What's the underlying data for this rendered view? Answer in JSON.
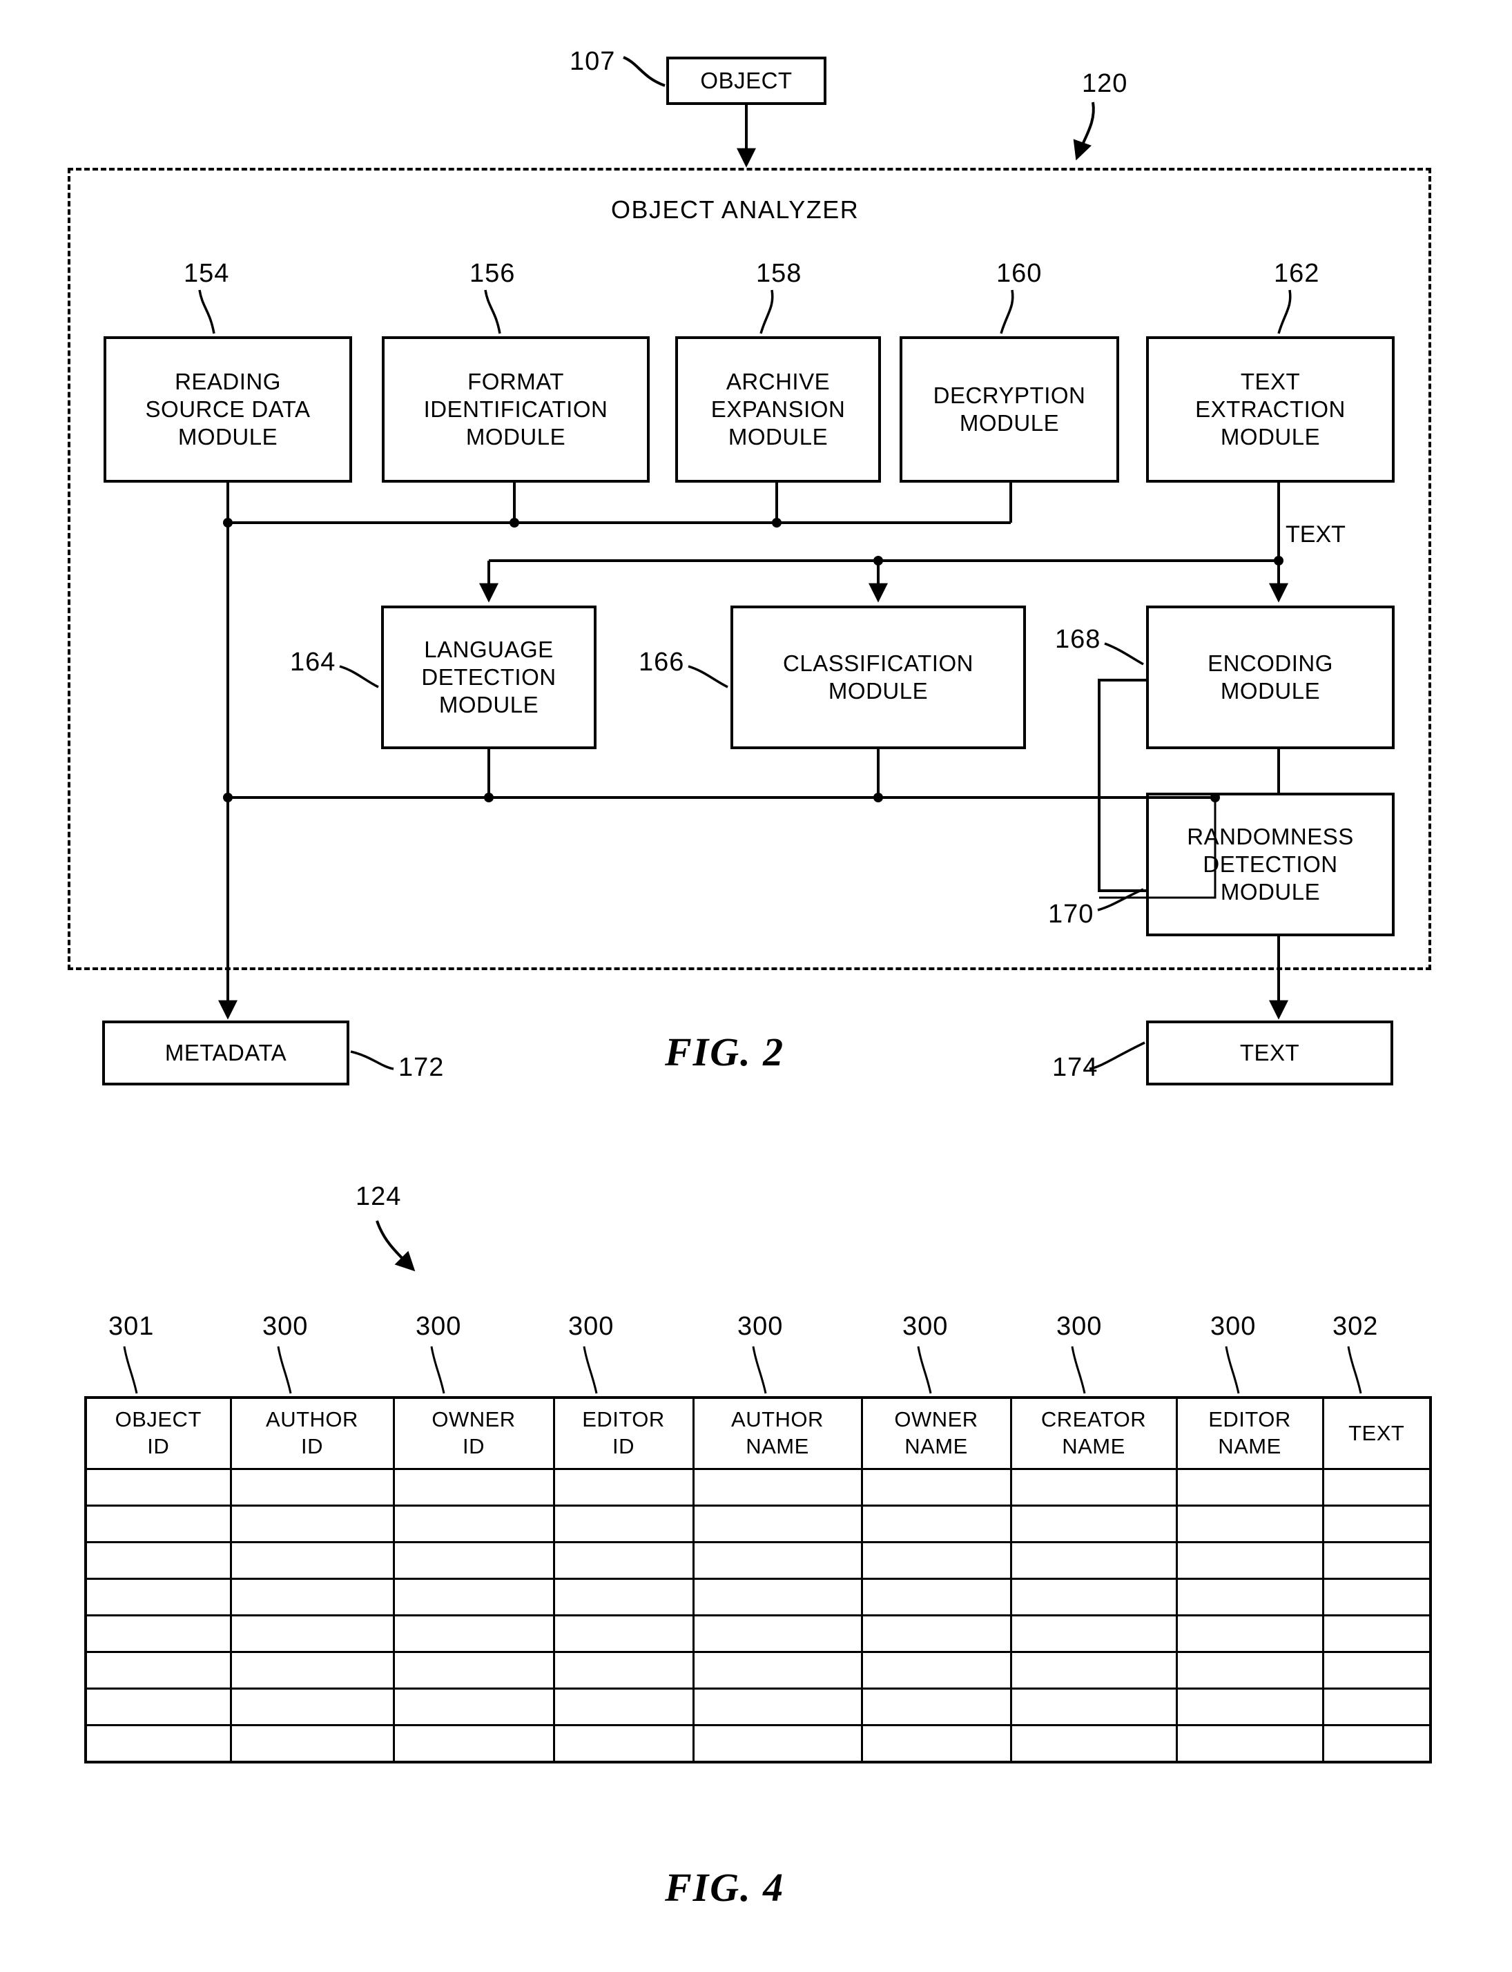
{
  "figure2": {
    "fig_label": "FIG. 2",
    "input_box": {
      "label": "OBJECT",
      "ref": "107"
    },
    "container": {
      "title": "OBJECT ANALYZER",
      "ref": "120"
    },
    "top_modules": [
      {
        "ref": "154",
        "lines": [
          "READING",
          "SOURCE DATA",
          "MODULE"
        ]
      },
      {
        "ref": "156",
        "lines": [
          "FORMAT",
          "IDENTIFICATION",
          "MODULE"
        ]
      },
      {
        "ref": "158",
        "lines": [
          "ARCHIVE",
          "EXPANSION",
          "MODULE"
        ]
      },
      {
        "ref": "160",
        "lines": [
          "DECRYPTION",
          "MODULE"
        ]
      },
      {
        "ref": "162",
        "lines": [
          "TEXT",
          "EXTRACTION",
          "MODULE"
        ]
      }
    ],
    "mid_modules": [
      {
        "ref": "164",
        "lines": [
          "LANGUAGE",
          "DETECTION",
          "MODULE"
        ]
      },
      {
        "ref": "166",
        "lines": [
          "CLASSIFICATION",
          "MODULE"
        ]
      },
      {
        "ref": "168",
        "lines": [
          "ENCODING",
          "MODULE"
        ]
      },
      {
        "ref": "170",
        "lines": [
          "RANDOMNESS",
          "DETECTION",
          "MODULE"
        ]
      }
    ],
    "wire_labels": [
      {
        "text": "TEXT"
      }
    ],
    "outputs": [
      {
        "ref": "172",
        "label": "METADATA"
      },
      {
        "ref": "174",
        "label": "TEXT"
      }
    ]
  },
  "figure4": {
    "fig_label": "FIG. 4",
    "ref": "124",
    "column_refs": [
      "301",
      "300",
      "300",
      "300",
      "300",
      "300",
      "300",
      "300",
      "302"
    ],
    "columns": [
      [
        "OBJECT",
        "ID"
      ],
      [
        "AUTHOR",
        "ID"
      ],
      [
        "OWNER",
        "ID"
      ],
      [
        "EDITOR",
        "ID"
      ],
      [
        "AUTHOR",
        "NAME"
      ],
      [
        "OWNER",
        "NAME"
      ],
      [
        "CREATOR",
        "NAME"
      ],
      [
        "EDITOR",
        "NAME"
      ],
      [
        "TEXT"
      ]
    ],
    "body_row_count": 8
  },
  "colors": {
    "ink": "#000000",
    "paper": "#ffffff"
  }
}
